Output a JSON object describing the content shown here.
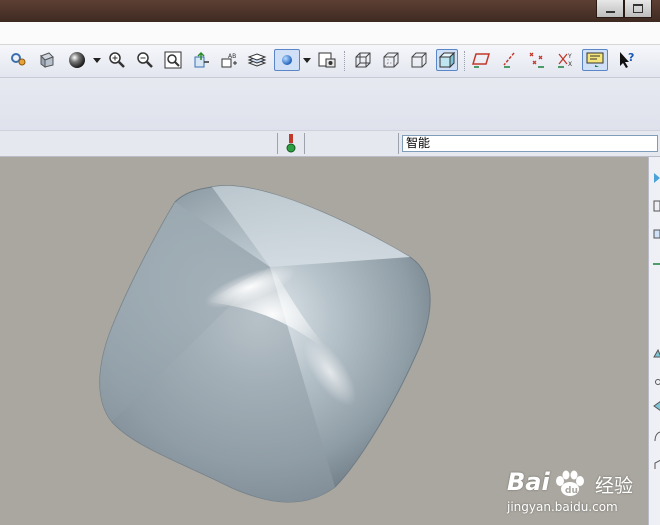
{
  "statusbar": {
    "filter_value": "智能"
  },
  "watermark": {
    "brand_a": "Bai",
    "brand_b": "经验",
    "url": "jingyan.baidu.com"
  },
  "colors": {
    "viewport_bg": "#a9a79f",
    "model_surface": "#8e9ba3",
    "toolbar_bg": "#e8ebf2",
    "active_tool": "#cfe0f7"
  },
  "toolbar_icons": [
    "regenerate-icon",
    "repaint-icon",
    "shading-sphere-icon",
    "zoom-in-icon",
    "zoom-out-icon",
    "refit-icon",
    "reorient-icon",
    "saved-views-icon",
    "layers-icon",
    "appearance-icon",
    "view-manager-icon",
    "wireframe-icon",
    "hidden-line-icon",
    "no-hidden-icon",
    "shaded-cube-icon",
    "datum-planes-icon",
    "datum-axes-icon",
    "datum-points-icon",
    "coordinate-systems-icon",
    "annotations-icon",
    "context-help-icon"
  ]
}
